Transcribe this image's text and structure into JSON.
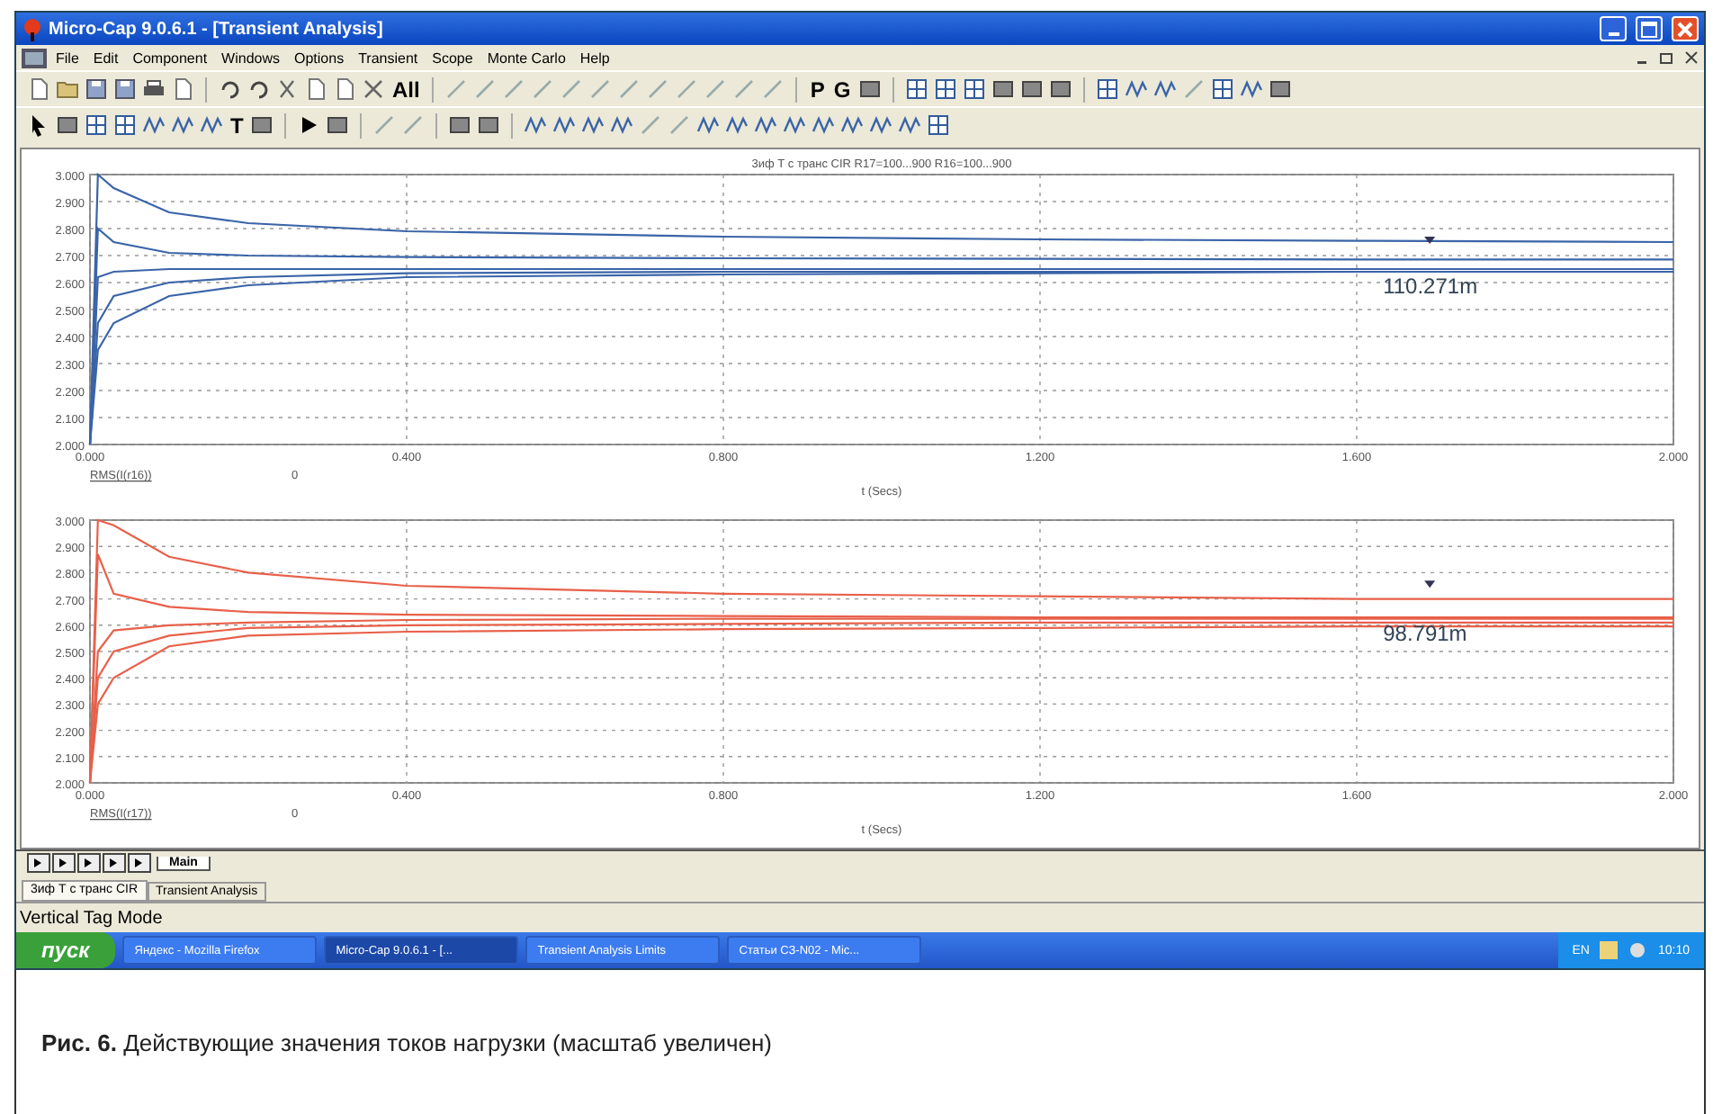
{
  "window": {
    "title": "Micro-Cap 9.0.6.1 - [Transient Analysis]"
  },
  "menu": [
    "File",
    "Edit",
    "Component",
    "Windows",
    "Options",
    "Transient",
    "Scope",
    "Monte Carlo",
    "Help"
  ],
  "toolbar_texts": [
    {
      "label": "All"
    },
    {
      "label": "P"
    },
    {
      "label": "G"
    },
    {
      "label": "T"
    }
  ],
  "plots": [
    {
      "trace_label": "RMS(I(r16))",
      "cursor_value": "0",
      "chart_data": {
        "type": "line",
        "grid": true,
        "title": "3иф Т с транс CIR R17=100...900 R16=100...900",
        "xlabel": "t (Secs)",
        "x": [
          0,
          0.01,
          0.03,
          0.1,
          0.2,
          0.4,
          0.8,
          1.2,
          1.6,
          2.0
        ],
        "xlim": [
          0,
          2
        ],
        "ylim": [
          2,
          3
        ],
        "xticks": [
          {
            "value": 0,
            "label": "0.000"
          },
          {
            "value": 0.4,
            "label": "0.400"
          },
          {
            "value": 0.8,
            "label": "0.800"
          },
          {
            "value": 1.2,
            "label": "1.200"
          },
          {
            "value": 1.6,
            "label": "1.600"
          },
          {
            "value": 2,
            "label": "2.000"
          }
        ],
        "yticks": [
          {
            "value": 2,
            "label": "2.000"
          },
          {
            "value": 2.1,
            "label": "2.100"
          },
          {
            "value": 2.2,
            "label": "2.200"
          },
          {
            "value": 2.3,
            "label": "2.300"
          },
          {
            "value": 2.4,
            "label": "2.400"
          },
          {
            "value": 2.5,
            "label": "2.500"
          },
          {
            "value": 2.6,
            "label": "2.600"
          },
          {
            "value": 2.7,
            "label": "2.700"
          },
          {
            "value": 2.8,
            "label": "2.800"
          },
          {
            "value": 2.9,
            "label": "2.900"
          },
          {
            "value": 3,
            "label": "3.000"
          }
        ],
        "series": [
          {
            "color": "#3a64a8",
            "values": [
              2.0,
              3.0,
              2.95,
              2.86,
              2.82,
              2.79,
              2.77,
              2.76,
              2.755,
              2.75
            ]
          },
          {
            "color": "#3a64a8",
            "values": [
              2.0,
              2.8,
              2.75,
              2.71,
              2.7,
              2.695,
              2.69,
              2.688,
              2.685,
              2.685
            ]
          },
          {
            "color": "#3a64a8",
            "values": [
              2.0,
              2.62,
              2.64,
              2.65,
              2.65,
              2.65,
              2.65,
              2.65,
              2.65,
              2.65
            ]
          },
          {
            "color": "#3a64a8",
            "values": [
              2.0,
              2.45,
              2.55,
              2.6,
              2.62,
              2.635,
              2.64,
              2.64,
              2.64,
              2.64
            ]
          },
          {
            "color": "#3a64a8",
            "values": [
              2.0,
              2.35,
              2.45,
              2.55,
              2.59,
              2.62,
              2.63,
              2.635,
              2.64,
              2.64
            ]
          }
        ],
        "annotations": [
          "110.271m"
        ]
      }
    },
    {
      "trace_label": "RMS(I(r17))",
      "cursor_value": "0",
      "chart_data": {
        "type": "line",
        "grid": true,
        "xlabel": "t (Secs)",
        "x": [
          0,
          0.01,
          0.03,
          0.1,
          0.2,
          0.4,
          0.8,
          1.2,
          1.6,
          2.0
        ],
        "xlim": [
          0,
          2
        ],
        "ylim": [
          2,
          3
        ],
        "xticks": [
          {
            "value": 0,
            "label": "0.000"
          },
          {
            "value": 0.4,
            "label": "0.400"
          },
          {
            "value": 0.8,
            "label": "0.800"
          },
          {
            "value": 1.2,
            "label": "1.200"
          },
          {
            "value": 1.6,
            "label": "1.600"
          },
          {
            "value": 2,
            "label": "2.000"
          }
        ],
        "yticks": [
          {
            "value": 2,
            "label": "2.000"
          },
          {
            "value": 2.1,
            "label": "2.100"
          },
          {
            "value": 2.2,
            "label": "2.200"
          },
          {
            "value": 2.3,
            "label": "2.300"
          },
          {
            "value": 2.4,
            "label": "2.400"
          },
          {
            "value": 2.5,
            "label": "2.500"
          },
          {
            "value": 2.6,
            "label": "2.600"
          },
          {
            "value": 2.7,
            "label": "2.700"
          },
          {
            "value": 2.8,
            "label": "2.800"
          },
          {
            "value": 2.9,
            "label": "2.900"
          },
          {
            "value": 3,
            "label": "3.000"
          }
        ],
        "series": [
          {
            "color": "#e8604a",
            "values": [
              2.0,
              3.0,
              2.98,
              2.86,
              2.8,
              2.75,
              2.72,
              2.71,
              2.7,
              2.7
            ]
          },
          {
            "color": "#e8604a",
            "values": [
              2.0,
              2.87,
              2.72,
              2.67,
              2.65,
              2.64,
              2.635,
              2.63,
              2.63,
              2.63
            ]
          },
          {
            "color": "#e8604a",
            "values": [
              2.0,
              2.5,
              2.58,
              2.6,
              2.61,
              2.62,
              2.625,
              2.625,
              2.625,
              2.625
            ]
          },
          {
            "color": "#e8604a",
            "values": [
              2.0,
              2.4,
              2.5,
              2.56,
              2.59,
              2.6,
              2.605,
              2.61,
              2.61,
              2.61
            ]
          },
          {
            "color": "#e8604a",
            "values": [
              2.0,
              2.3,
              2.4,
              2.52,
              2.56,
              2.575,
              2.585,
              2.59,
              2.595,
              2.595
            ]
          }
        ],
        "annotations": [
          "98.791m"
        ]
      }
    }
  ],
  "page_tabs": [
    {
      "label": "Main",
      "selected": true
    }
  ],
  "doc_tabs": [
    {
      "label": "3иф Т с транс CIR",
      "selected": true
    },
    {
      "label": "Transient Analysis",
      "selected": false
    }
  ],
  "status_bar": "Vertical Tag Mode",
  "taskbar": {
    "start": "пуск",
    "tasks": [
      {
        "label": "Яндекс - Mozilla Firefox",
        "selected": false
      },
      {
        "label": "Micro-Cap 9.0.6.1 - [...",
        "selected": true
      },
      {
        "label": "Transient Analysis Limits",
        "selected": false
      },
      {
        "label": "Статьи СЗ-N02 - Mic...",
        "selected": false
      }
    ],
    "language": "EN",
    "clock": "10:10"
  },
  "caption": "**Рис. 6.** Действующие значения токов нагрузки (масштаб увеличен)"
}
